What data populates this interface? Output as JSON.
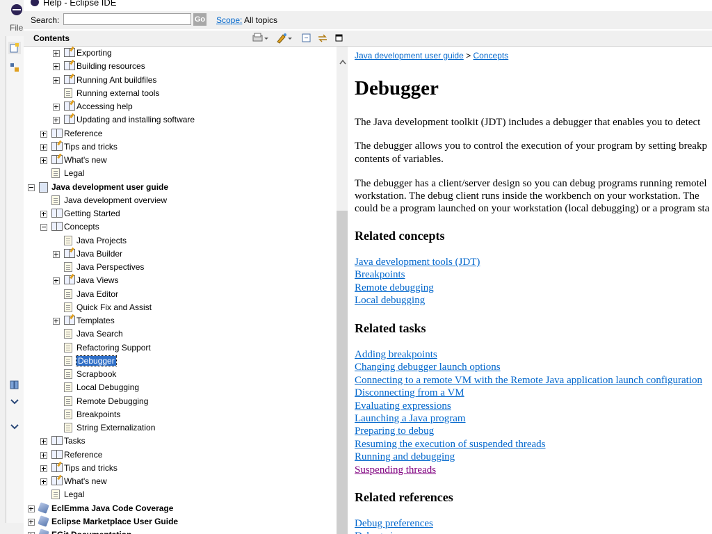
{
  "window": {
    "title": "Help - Eclipse IDE"
  },
  "eclipse_bg": {
    "file_menu": "File"
  },
  "search": {
    "label": "Search:",
    "value": "",
    "go": "Go",
    "scope_link": "Scope:",
    "scope_value": "All topics"
  },
  "contents": {
    "title": "Contents"
  },
  "tree": [
    {
      "label": "Exporting",
      "level": 2,
      "exp": "plus",
      "icon": "book pen"
    },
    {
      "label": "Building resources",
      "level": 2,
      "exp": "plus",
      "icon": "book pen"
    },
    {
      "label": "Running Ant buildfiles",
      "level": 2,
      "exp": "plus",
      "icon": "book pen"
    },
    {
      "label": "Running external tools",
      "level": 2,
      "exp": "",
      "icon": "page"
    },
    {
      "label": "Accessing help",
      "level": 2,
      "exp": "plus",
      "icon": "book pen"
    },
    {
      "label": "Updating and installing software",
      "level": 2,
      "exp": "plus",
      "icon": "book pen"
    },
    {
      "label": "Reference",
      "level": 1,
      "exp": "plus",
      "icon": "book"
    },
    {
      "label": "Tips and tricks",
      "level": 1,
      "exp": "plus",
      "icon": "book pen"
    },
    {
      "label": "What's new",
      "level": 1,
      "exp": "plus",
      "icon": "book pen"
    },
    {
      "label": "Legal",
      "level": 1,
      "exp": "",
      "icon": "page"
    },
    {
      "label": "Java development user guide",
      "level": 0,
      "exp": "minus",
      "icon": "bookgrey",
      "bold": true
    },
    {
      "label": "Java development overview",
      "level": 1,
      "exp": "",
      "icon": "page"
    },
    {
      "label": "Getting Started",
      "level": 1,
      "exp": "plus",
      "icon": "book"
    },
    {
      "label": "Concepts",
      "level": 1,
      "exp": "minus",
      "icon": "book"
    },
    {
      "label": "Java Projects",
      "level": 2,
      "exp": "",
      "icon": "page"
    },
    {
      "label": "Java Builder",
      "level": 2,
      "exp": "plus",
      "icon": "book pen"
    },
    {
      "label": "Java Perspectives",
      "level": 2,
      "exp": "",
      "icon": "page"
    },
    {
      "label": "Java Views",
      "level": 2,
      "exp": "plus",
      "icon": "book pen"
    },
    {
      "label": "Java Editor",
      "level": 2,
      "exp": "",
      "icon": "page"
    },
    {
      "label": "Quick Fix and Assist",
      "level": 2,
      "exp": "",
      "icon": "page"
    },
    {
      "label": "Templates",
      "level": 2,
      "exp": "plus",
      "icon": "book pen"
    },
    {
      "label": "Java Search",
      "level": 2,
      "exp": "",
      "icon": "page"
    },
    {
      "label": "Refactoring Support",
      "level": 2,
      "exp": "",
      "icon": "page"
    },
    {
      "label": "Debugger",
      "level": 2,
      "exp": "",
      "icon": "page",
      "selected": true
    },
    {
      "label": "Scrapbook",
      "level": 2,
      "exp": "",
      "icon": "page"
    },
    {
      "label": "Local Debugging",
      "level": 2,
      "exp": "",
      "icon": "page"
    },
    {
      "label": "Remote Debugging",
      "level": 2,
      "exp": "",
      "icon": "page"
    },
    {
      "label": "Breakpoints",
      "level": 2,
      "exp": "",
      "icon": "page"
    },
    {
      "label": "String Externalization",
      "level": 2,
      "exp": "",
      "icon": "page"
    },
    {
      "label": "Tasks",
      "level": 1,
      "exp": "plus",
      "icon": "book"
    },
    {
      "label": "Reference",
      "level": 1,
      "exp": "plus",
      "icon": "book"
    },
    {
      "label": "Tips and tricks",
      "level": 1,
      "exp": "plus",
      "icon": "book pen"
    },
    {
      "label": "What's new",
      "level": 1,
      "exp": "plus",
      "icon": "book pen"
    },
    {
      "label": "Legal",
      "level": 1,
      "exp": "",
      "icon": "page"
    },
    {
      "label": "EclEmma Java Code Coverage",
      "level": 0,
      "exp": "plus",
      "icon": "gem",
      "bold": true
    },
    {
      "label": "Eclipse Marketplace User Guide",
      "level": 0,
      "exp": "plus",
      "icon": "gem",
      "bold": true
    },
    {
      "label": "EGit Documentation",
      "level": 0,
      "exp": "plus",
      "icon": "gem",
      "bold": true
    }
  ],
  "article": {
    "breadcrumb": [
      "Java development user guide",
      "Concepts"
    ],
    "breadcrumb_sep": ">",
    "title": "Debugger",
    "para1": "The Java development toolkit (JDT) includes a debugger that enables you to detect",
    "para2_line1": "The debugger allows you to control the execution of your program by setting breakp",
    "para2_line2": "contents of variables.",
    "para3_line1": "The debugger has a client/server design so you can debug programs running remotel",
    "para3_line2": "workstation. The debug client runs inside the workbench on your workstation.  The",
    "para3_line3": "could be a program launched on your workstation (local debugging) or a program sta",
    "related_concepts_heading": "Related concepts",
    "related_concepts": [
      "Java development tools (JDT)",
      "Breakpoints",
      "Remote debugging",
      "Local debugging"
    ],
    "related_tasks_heading": "Related tasks",
    "related_tasks": [
      "Adding breakpoints",
      "Changing debugger launch options",
      "Connecting to a remote VM with the Remote Java application launch configuration",
      "Disconnecting from a VM",
      "Evaluating expressions",
      "Launching a Java program",
      "Preparing to debug",
      "Resuming the execution of suspended threads",
      "Running and debugging",
      "Suspending threads"
    ],
    "visited_task": "Suspending threads",
    "related_references_heading": "Related references",
    "related_references": [
      "Debug preferences",
      "Debug view"
    ]
  },
  "colors": {
    "link": "#0066cc",
    "visited": "#800080",
    "selection": "#3070c8"
  }
}
